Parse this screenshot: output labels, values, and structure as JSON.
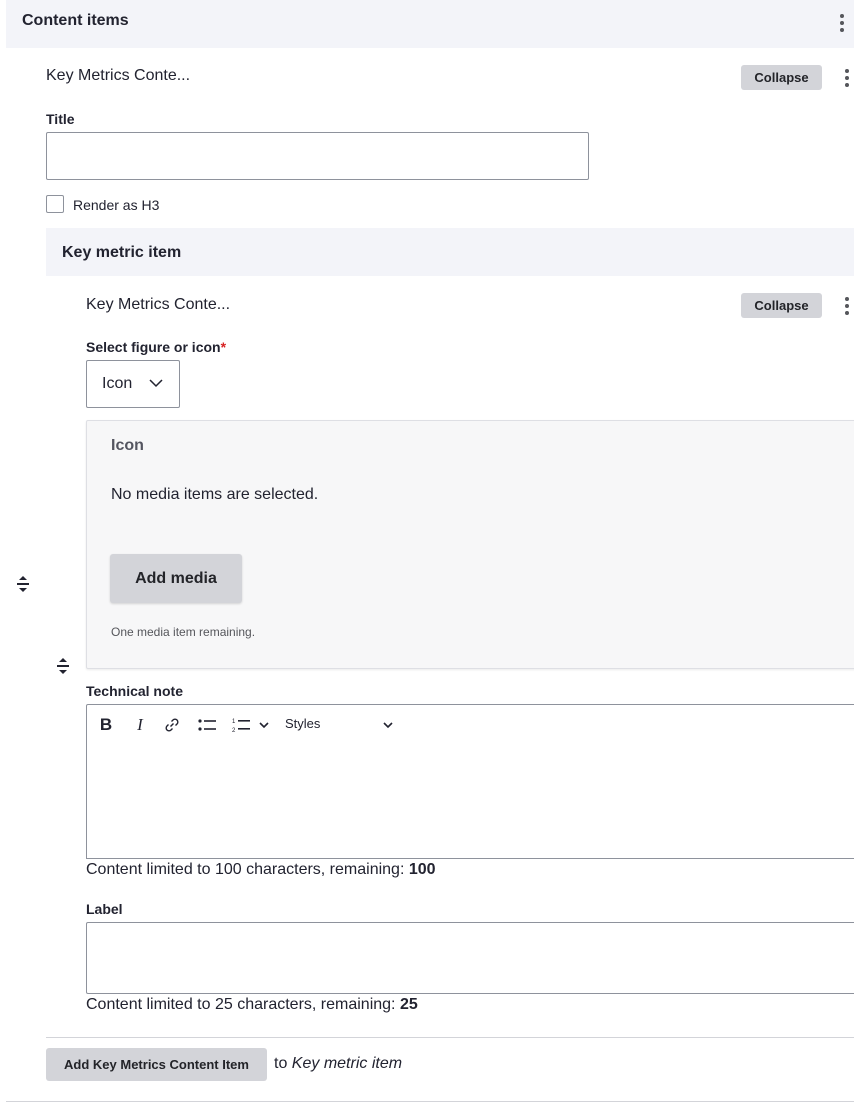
{
  "section": {
    "title": "Content items"
  },
  "paragraph": {
    "summary": "Key Metrics Conte...",
    "collapse_label": "Collapse",
    "title_label": "Title",
    "title_value": "",
    "render_h3_label": "Render as H3",
    "render_h3_checked": false
  },
  "key_metric": {
    "title": "Key metric item",
    "summary": "Key Metrics Conte...",
    "collapse_label": "Collapse",
    "select_label": "Select figure or icon",
    "required_mark": "*",
    "select_value": "Icon",
    "icon": {
      "title": "Icon",
      "empty_text": "No media items are selected.",
      "add_media_label": "Add media",
      "remaining_text": "One media item remaining."
    },
    "technical_note": {
      "label": "Technical note",
      "toolbar": {
        "bold": "B",
        "italic": "I",
        "styles_label": "Styles"
      },
      "counter_text": "Content limited to 100 characters, remaining: ",
      "counter_value": "100"
    },
    "label_field": {
      "label": "Label",
      "value": "",
      "counter_text": "Content limited to 25 characters, remaining: ",
      "counter_value": "25"
    }
  },
  "add_item": {
    "button_label": "Add Key Metrics Content Item",
    "to_text": "to",
    "target": "Key metric item"
  }
}
